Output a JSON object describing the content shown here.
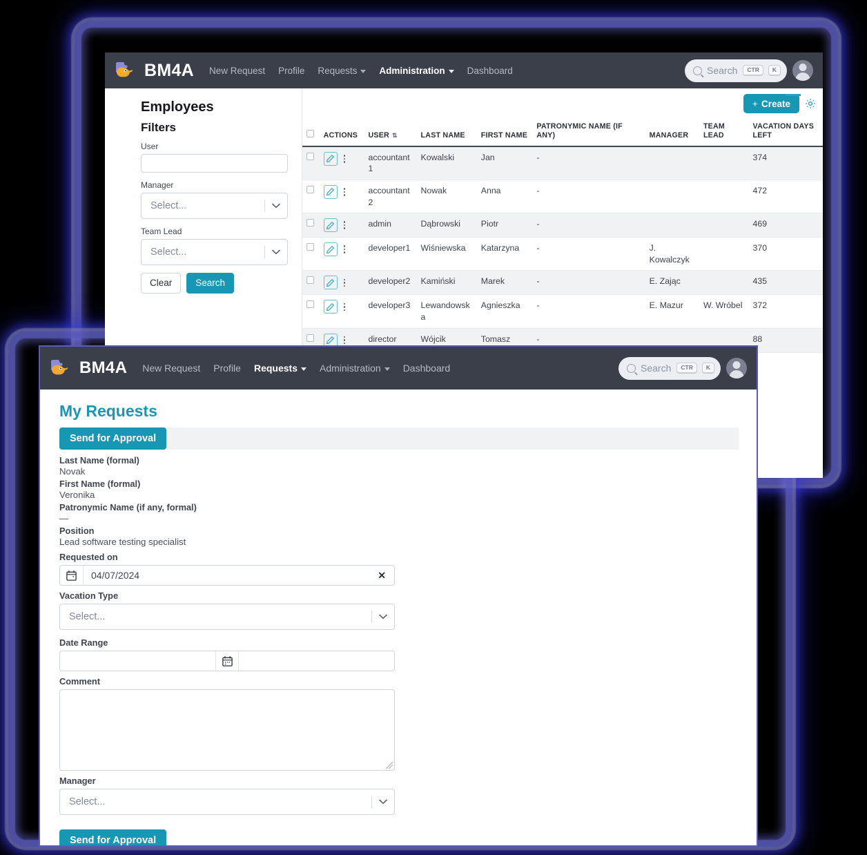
{
  "brand": {
    "name": "BM4A",
    "logo_icon": "puzzle-bird-logo"
  },
  "back_window": {
    "nav": {
      "links": [
        {
          "label": "New Request",
          "active": false,
          "has_caret": false
        },
        {
          "label": "Profile",
          "active": false,
          "has_caret": false
        },
        {
          "label": "Requests",
          "active": false,
          "has_caret": true
        },
        {
          "label": "Administration",
          "active": true,
          "has_caret": true
        },
        {
          "label": "Dashboard",
          "active": false,
          "has_caret": false
        }
      ],
      "search": {
        "placeholder": "Search",
        "kbd1": "CTR",
        "kbd2": "K",
        "icon": "search-icon"
      },
      "avatar_icon": "user-avatar-icon"
    },
    "page_title": "Employees",
    "filters": {
      "title": "Filters",
      "user_label": "User",
      "user_value": "",
      "manager_label": "Manager",
      "manager_placeholder": "Select...",
      "team_lead_label": "Team Lead",
      "team_lead_placeholder": "Select...",
      "clear_label": "Clear",
      "search_label": "Search"
    },
    "toolbar": {
      "create_label": "Create",
      "create_plus": "+",
      "gear_icon": "gear-icon"
    },
    "table": {
      "columns": [
        "ACTIONS",
        "USER",
        "LAST NAME",
        "FIRST NAME",
        "PATRONYMIC NAME (IF ANY)",
        "MANAGER",
        "TEAM LEAD",
        "VACATION DAYS LEFT"
      ],
      "sort_indicator": "⇅",
      "rows": [
        {
          "user": "accountant1",
          "last_name": "Kowalski",
          "first_name": "Jan",
          "patronymic": "-",
          "manager": "",
          "team_lead": "",
          "days_left": "374"
        },
        {
          "user": "accountant2",
          "last_name": "Nowak",
          "first_name": "Anna",
          "patronymic": "-",
          "manager": "",
          "team_lead": "",
          "days_left": "472"
        },
        {
          "user": "admin",
          "last_name": "Dąbrowski",
          "first_name": "Piotr",
          "patronymic": "-",
          "manager": "",
          "team_lead": "",
          "days_left": "469"
        },
        {
          "user": "developer1",
          "last_name": "Wiśniewska",
          "first_name": "Katarzyna",
          "patronymic": "-",
          "manager": "J. Kowalczyk",
          "team_lead": "",
          "days_left": "370"
        },
        {
          "user": "developer2",
          "last_name": "Kamiński",
          "first_name": "Marek",
          "patronymic": "-",
          "manager": "E. Zając",
          "team_lead": "",
          "days_left": "435"
        },
        {
          "user": "developer3",
          "last_name": "Lewandowska",
          "first_name": "Agnieszka",
          "patronymic": "-",
          "manager": "E. Mazur",
          "team_lead": "W. Wróbel",
          "days_left": "372"
        },
        {
          "user": "director",
          "last_name": "Wójcik",
          "first_name": "Tomasz",
          "patronymic": "-",
          "manager": "",
          "team_lead": "",
          "days_left": "88"
        }
      ]
    }
  },
  "front_window": {
    "nav": {
      "links": [
        {
          "label": "New Request",
          "active": false,
          "has_caret": false
        },
        {
          "label": "Profile",
          "active": false,
          "has_caret": false
        },
        {
          "label": "Requests",
          "active": true,
          "has_caret": true
        },
        {
          "label": "Administration",
          "active": false,
          "has_caret": true
        },
        {
          "label": "Dashboard",
          "active": false,
          "has_caret": false
        }
      ],
      "search": {
        "placeholder": "Search",
        "kbd1": "CTR",
        "kbd2": "K",
        "icon": "search-icon"
      },
      "avatar_icon": "user-avatar-icon"
    },
    "title": "My Requests",
    "send_top_label": "Send for Approval",
    "send_bottom_label": "Send for Approval",
    "fields": {
      "last_name_label": "Last Name (formal)",
      "last_name_value": "Novak",
      "first_name_label": "First Name (formal)",
      "first_name_value": "Veronika",
      "patronymic_label": "Patronymic Name (if any, formal)",
      "patronymic_value": "—",
      "position_label": "Position",
      "position_value": "Lead software testing specialist",
      "requested_on_label": "Requested on",
      "requested_on_value": "04/07/2024",
      "requested_on_clear": "✕",
      "vacation_type_label": "Vacation Type",
      "vacation_type_placeholder": "Select...",
      "date_range_label": "Date Range",
      "date_range_start": "",
      "date_range_end": "",
      "comment_label": "Comment",
      "comment_value": "",
      "manager_label": "Manager",
      "manager_placeholder": "Select..."
    }
  },
  "colors": {
    "navbar": "#3b3f4a",
    "accent_teal": "#1897b5",
    "glow_purple": "#5c5cbe",
    "row_stripe": "#f1f2f4"
  }
}
